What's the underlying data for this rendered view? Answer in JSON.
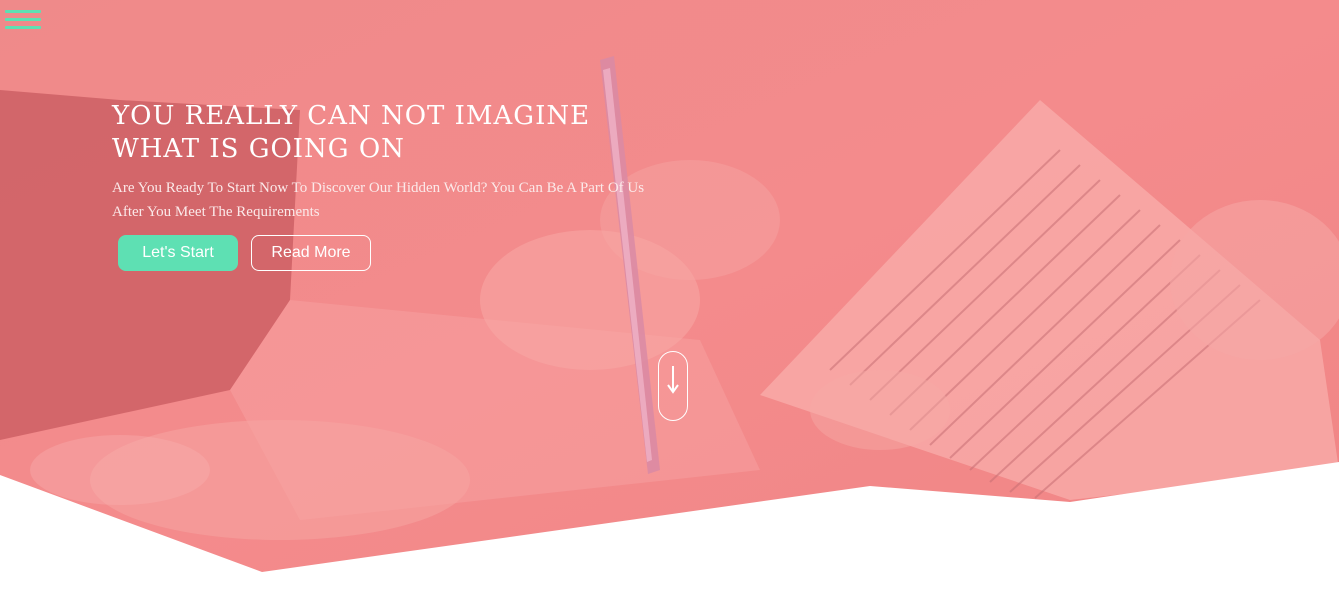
{
  "nav": {
    "menu_icon": "hamburger-icon"
  },
  "hero": {
    "title": "YOU REALLY CAN NOT IMAGINE WHAT IS GOING ON",
    "subtitle": "Are You Ready To Start Now To Discover Our Hidden World? You Can Be A Part Of Us After You Meet The Requirements",
    "primary_button_label": "Let's Start",
    "secondary_button_label": "Read More",
    "scroll_icon": "arrow-down-icon",
    "background_image": "hands-with-pen-and-document",
    "overlay_color": "#f3777a"
  },
  "colors": {
    "accent": "#5ee0b3",
    "overlay": "#f3777a",
    "background": "#ffffff"
  }
}
